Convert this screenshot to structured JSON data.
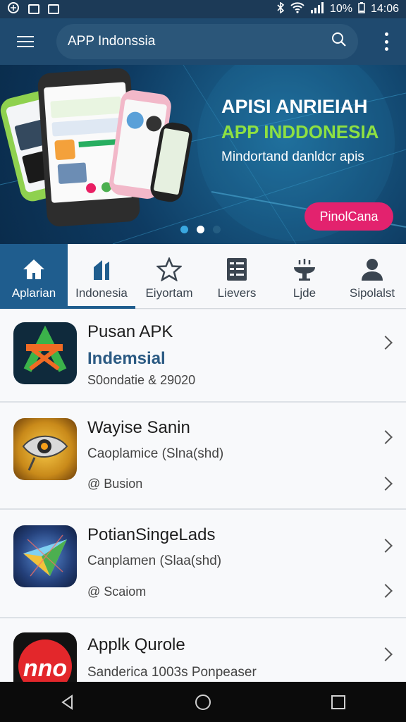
{
  "status_bar": {
    "battery": "10%",
    "time": "14:06",
    "icons": [
      "usb-icon",
      "image-icon",
      "nfc-icon",
      "bluetooth-icon",
      "wifi-icon",
      "signal-icon",
      "battery-icon"
    ]
  },
  "app_bar": {
    "search_value": "APP Indonssia",
    "icons": [
      "menu-icon",
      "search-icon",
      "more-vert-icon"
    ]
  },
  "banner": {
    "title": "APISI ANRIEIAH",
    "subtitle": "APP INDDONESIA",
    "description": "Mindortand danldcr apis",
    "cta": "PinolCana",
    "slides_total": 3,
    "slide_active": 2,
    "colors": {
      "subtitle": "#8ee042",
      "cta": "#e3226e"
    }
  },
  "tabs": [
    {
      "label": "Aplarian",
      "icon": "home-icon",
      "active": true
    },
    {
      "label": "Indonesia",
      "icon": "chart-icon",
      "active": false,
      "underlined": true
    },
    {
      "label": "Eiyortam",
      "icon": "star-icon",
      "active": false
    },
    {
      "label": "Lievers",
      "icon": "list-icon",
      "active": false
    },
    {
      "label": "Ljde",
      "icon": "fountain-icon",
      "active": false
    },
    {
      "label": "Sipolalst",
      "icon": "user-icon",
      "active": false
    }
  ],
  "apps": [
    {
      "name": "Pusan APK",
      "line2": "Indemsial",
      "line3": "S0ondatie & 29020"
    },
    {
      "name": "Wayise Sanin",
      "line2": "Caoplamice (Slna(shd)",
      "line3": "Busion"
    },
    {
      "name": "PotianSingeLads",
      "line2": "Canplamen (Slaa(shd)",
      "line3": "Scaiom"
    },
    {
      "name": "Applk Qurole",
      "line2": "Sanderica  1003s Ponpeaser"
    }
  ],
  "nav_icons": [
    "back-icon",
    "home-circle-icon",
    "recents-icon"
  ]
}
